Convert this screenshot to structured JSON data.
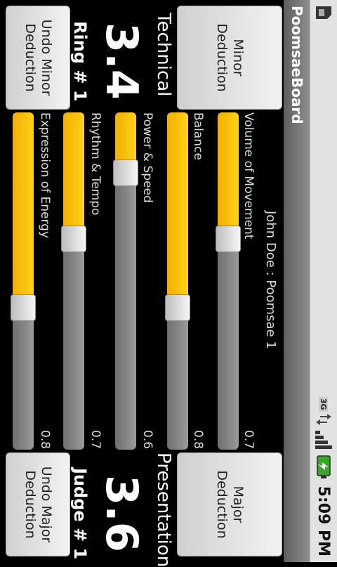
{
  "status_bar": {
    "network": "3G",
    "time": "5:09 PM",
    "icons": [
      "sim-icon",
      "data-activity-icon",
      "signal-icon",
      "battery-charging-icon"
    ]
  },
  "app": {
    "title": "PoomsaeBoard"
  },
  "buttons": {
    "minor_deduction": "Minor\nDeduction",
    "major_deduction": "Major\nDeduction",
    "undo_minor": "Undo Minor\nDeduction",
    "undo_major": "Undo Major\nDeduction"
  },
  "technical": {
    "label": "Technical",
    "score": "3.4",
    "ring": "Ring # 1"
  },
  "presentation": {
    "label": "Presentation",
    "score": "3.6",
    "judge": "Judge # 1"
  },
  "athlete": "John Doe : Poomsae 1",
  "criteria": [
    {
      "label": "Volume of Movement",
      "value": "0.7",
      "fraction": 0.375
    },
    {
      "label": "Balance",
      "value": "0.8",
      "fraction": 0.58
    },
    {
      "label": "Power & Speed",
      "value": "0.6",
      "fraction": 0.18
    },
    {
      "label": "Rhythm & Tempo",
      "value": "0.7",
      "fraction": 0.375
    },
    {
      "label": "Expression of Energy",
      "value": "0.8",
      "fraction": 0.58
    }
  ],
  "colors": {
    "fill": "#f7b800",
    "track": "#808080",
    "titlebar": "#6a6a6a"
  }
}
